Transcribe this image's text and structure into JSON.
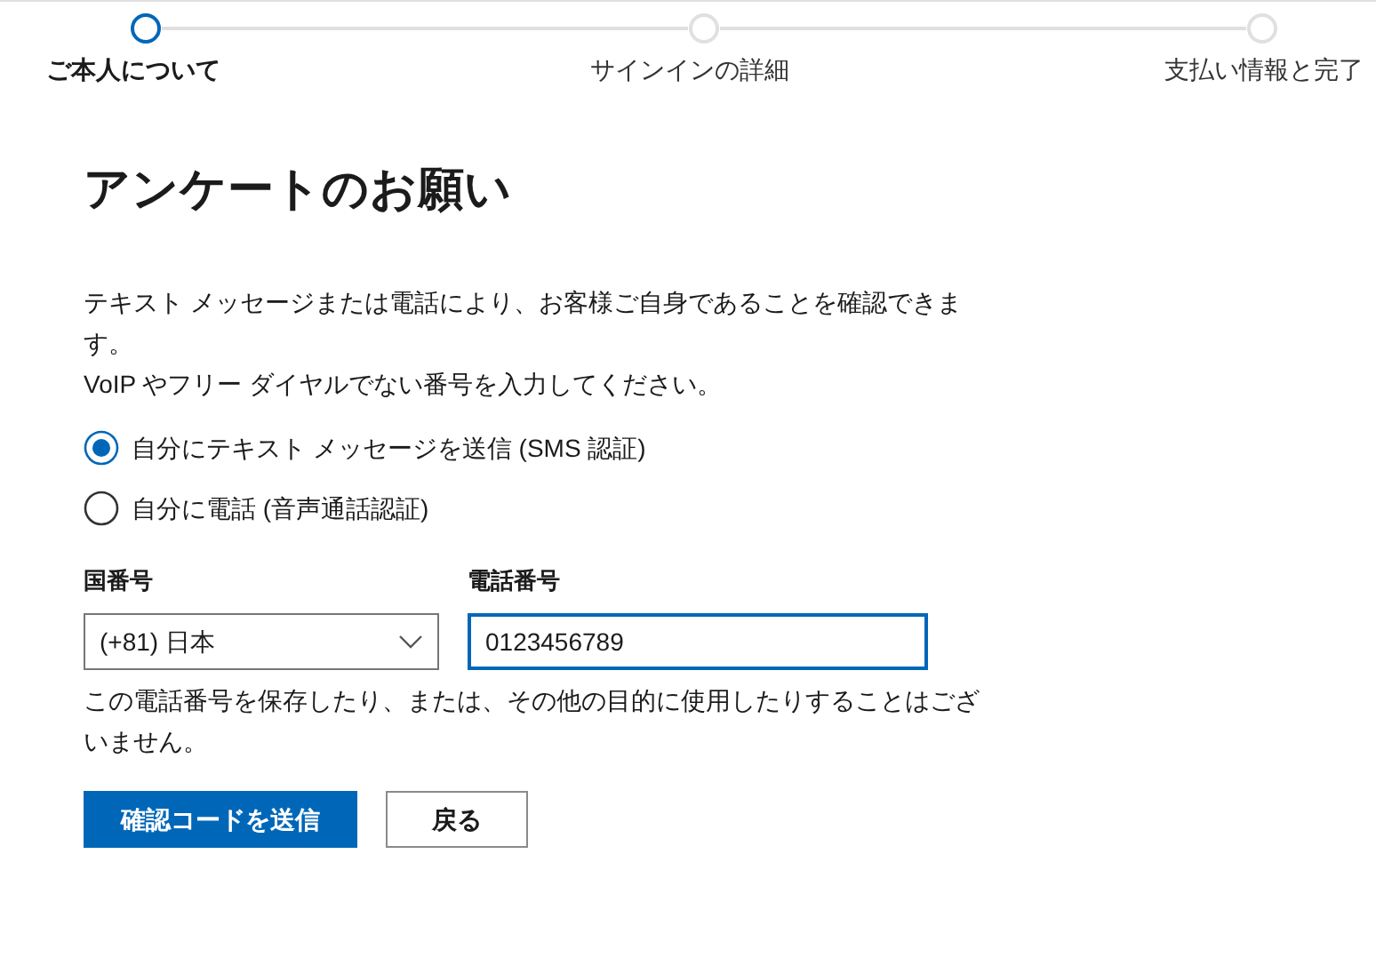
{
  "steps": [
    {
      "label": "ご本人について",
      "selected": true
    },
    {
      "label": "サインインの詳細",
      "selected": false
    },
    {
      "label": "支払い情報と完了",
      "selected": false
    }
  ],
  "title": "アンケートのお願い",
  "description": [
    "テキスト メッセージまたは電話により、お客様ご自身であることを確認できます。",
    "VoIP やフリー ダイヤルでない番号を入力してください。"
  ],
  "options": [
    {
      "label": "自分にテキスト メッセージを送信 (SMS 認証)",
      "selected": true
    },
    {
      "label": "自分に電話 (音声通話認証)",
      "selected": false
    }
  ],
  "country": {
    "label": "国番号",
    "value": "(+81) 日本"
  },
  "phone": {
    "label": "電話番号",
    "value": "0123456789"
  },
  "note": "この電話番号を保存したり、または、その他の目的に使用したりすることはございません。",
  "buttons": {
    "primary": "確認コードを送信",
    "secondary": "戻る"
  }
}
